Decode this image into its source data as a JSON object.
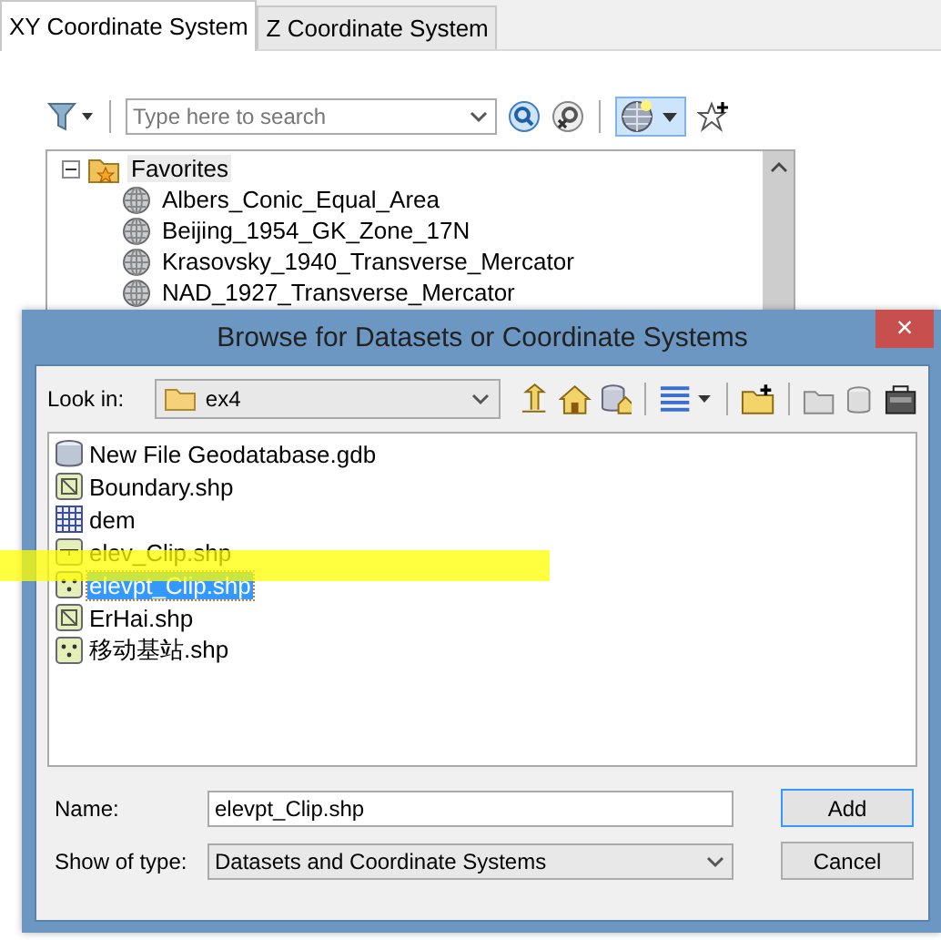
{
  "tabs": [
    {
      "label": "XY Coordinate System",
      "selected": true
    },
    {
      "label": "Z Coordinate System",
      "selected": false
    }
  ],
  "search": {
    "placeholder": "Type here to search"
  },
  "tree": {
    "label": "Favorites",
    "expanded": true,
    "selected": true,
    "children": [
      {
        "label": "Albers_Conic_Equal_Area",
        "selected": false
      },
      {
        "label": "Beijing_1954_GK_Zone_17N",
        "selected": false
      },
      {
        "label": "Krasovsky_1940_Transverse_Mercator",
        "selected": false
      },
      {
        "label": "NAD_1927_Transverse_Mercator",
        "selected": false
      }
    ]
  },
  "dialog": {
    "title": "Browse for Datasets or Coordinate Systems",
    "close": "×",
    "look_in_label": "Look in:",
    "look_in_value": "ex4",
    "files": [
      {
        "name": "New File Geodatabase.gdb",
        "kind": "gdb",
        "selected": false
      },
      {
        "name": "Boundary.shp",
        "kind": "polygon",
        "selected": false
      },
      {
        "name": "dem",
        "kind": "raster",
        "selected": false
      },
      {
        "name": "elev_Clip.shp",
        "kind": "line",
        "selected": false
      },
      {
        "name": "elevpt_Clip.shp",
        "kind": "point",
        "selected": true
      },
      {
        "name": "ErHai.shp",
        "kind": "polygon",
        "selected": false
      },
      {
        "name": "移动基站.shp",
        "kind": "point",
        "selected": false
      }
    ],
    "name_label": "Name:",
    "name_value": "elevpt_Clip.shp",
    "type_label": "Show of type:",
    "type_value": "Datasets and Coordinate Systems",
    "buttons": [
      "Add",
      "Cancel"
    ]
  }
}
